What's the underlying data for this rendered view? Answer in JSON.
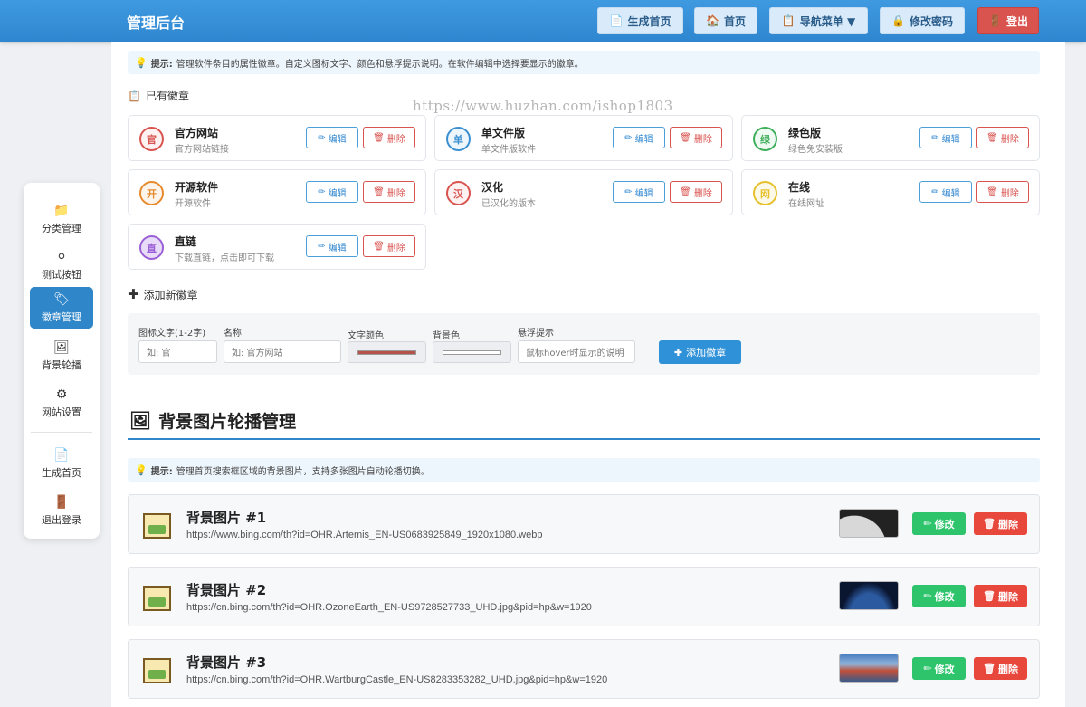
{
  "header": {
    "title": "管理后台",
    "buttons": [
      {
        "label": "生成首页",
        "icon": "📄"
      },
      {
        "label": "首页",
        "icon": "🏠"
      },
      {
        "label": "导航菜单 ▼",
        "icon": "📋"
      },
      {
        "label": "修改密码",
        "icon": "🔒"
      },
      {
        "label": "登出",
        "icon": "🚪"
      }
    ]
  },
  "badges_section": {
    "tip_prefix": "提示:",
    "tip_text": "管理软件条目的属性徽章。自定义图标文字、颜色和悬浮提示说明。在软件编辑中选择要显示的徽章。",
    "existing_title": "已有徽章",
    "edit_label": "编辑",
    "delete_label": "删除",
    "items": [
      {
        "char": "官",
        "name": "官方网站",
        "desc": "官方网站链接",
        "color": "#d9534f",
        "bg": "#fdf1f1"
      },
      {
        "char": "单",
        "name": "单文件版",
        "desc": "单文件版软件",
        "color": "#3a8fd0",
        "bg": "#eef6fd"
      },
      {
        "char": "绿",
        "name": "绿色版",
        "desc": "绿色免安装版",
        "color": "#3fae5a",
        "bg": "#effaf2"
      },
      {
        "char": "开",
        "name": "开源软件",
        "desc": "开源软件",
        "color": "#e68a2e",
        "bg": "#fdf5ec"
      },
      {
        "char": "汉",
        "name": "汉化",
        "desc": "已汉化的版本",
        "color": "#d9534f",
        "bg": "#fdf1f1"
      },
      {
        "char": "网",
        "name": "在线",
        "desc": "在线网址",
        "color": "#e6c12e",
        "bg": "#fdf9e9"
      },
      {
        "char": "直",
        "name": "直链",
        "desc": "下载直链，点击即可下载",
        "color": "#9a5fd6",
        "bg": "#e8dcf8"
      }
    ],
    "add_title": "添加新徽章",
    "form": {
      "icon_text_label": "图标文字(1-2字)",
      "icon_text_placeholder": "如: 官",
      "name_label": "名称",
      "name_placeholder": "如: 官方网站",
      "text_color_label": "文字颜色",
      "text_color_value": "#b5524a",
      "bg_color_label": "背景色",
      "bg_color_value": "#ffffff",
      "tooltip_label": "悬浮提示",
      "tooltip_placeholder": "鼠标hover时显示的说明",
      "add_button": "添加徽章"
    }
  },
  "carousel_section": {
    "title": "背景图片轮播管理",
    "tip_prefix": "提示:",
    "tip_text": "管理首页搜索框区域的背景图片，支持多张图片自动轮播切换。",
    "modify_label": "修改",
    "delete_label": "删除",
    "items": [
      {
        "title": "背景图片 #1",
        "url": "https://www.bing.com/th?id=OHR.Artemis_EN-US0683925849_1920x1080.webp"
      },
      {
        "title": "背景图片 #2",
        "url": "https://cn.bing.com/th?id=OHR.OzoneEarth_EN-US9728527733_UHD.jpg&pid=hp&w=1920"
      },
      {
        "title": "背景图片 #3",
        "url": "https://cn.bing.com/th?id=OHR.WartburgCastle_EN-US8283353282_UHD.jpg&pid=hp&w=1920"
      }
    ]
  },
  "sidebar": {
    "items": [
      {
        "label": "分类管理",
        "icon": "📁"
      },
      {
        "label": "测试按钮",
        "icon": "⚪"
      },
      {
        "label": "徽章管理",
        "icon": "🏷"
      },
      {
        "label": "背景轮播",
        "icon": "🖼"
      },
      {
        "label": "网站设置",
        "icon": "⚙"
      },
      {
        "label": "生成首页",
        "icon": "📄"
      },
      {
        "label": "退出登录",
        "icon": "🚪"
      }
    ],
    "active": "徽章管理"
  },
  "watermark": "https://www.huzhan.com/ishop1803"
}
